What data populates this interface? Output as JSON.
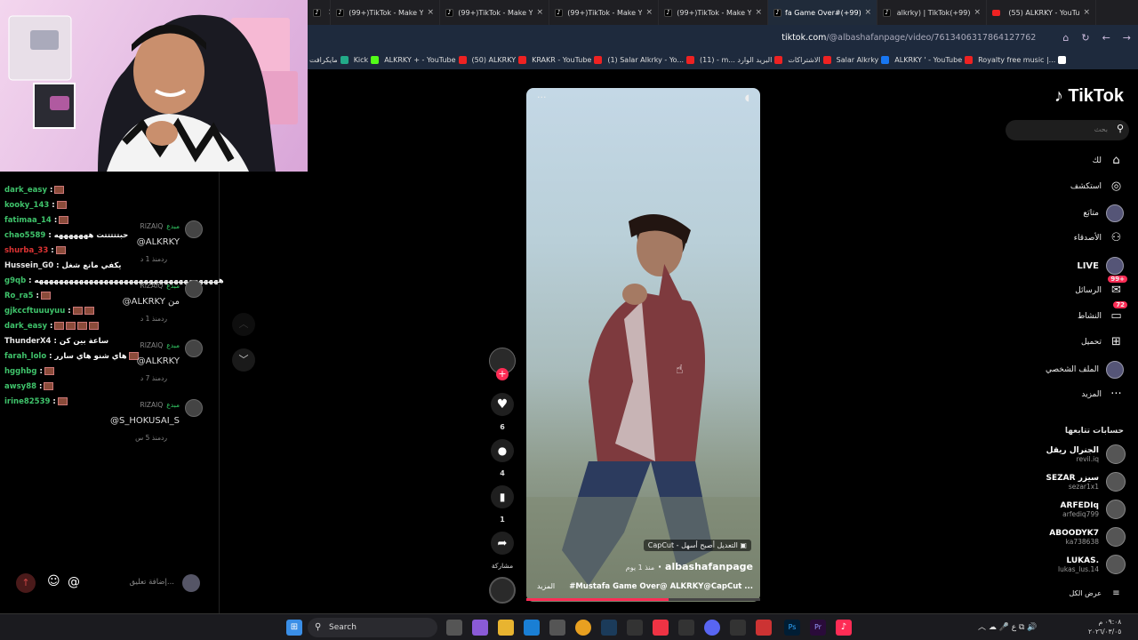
{
  "tabs": [
    {
      "label": "n",
      "icon": "tiktok-icon",
      "active": false
    },
    {
      "label": "(99+)TikTok - Make Y",
      "icon": "tiktok-icon",
      "active": false
    },
    {
      "label": "(99+)TikTok - Make Y",
      "icon": "tiktok-icon",
      "active": false
    },
    {
      "label": "(99+)TikTok - Make Y",
      "icon": "tiktok-icon",
      "active": false
    },
    {
      "label": "(99+)TikTok - Make Y",
      "icon": "tiktok-icon",
      "active": false
    },
    {
      "label": "fa Game Over#(+99)",
      "icon": "tiktok-icon",
      "active": true
    },
    {
      "label": "alkrky) | TikTok(+99)",
      "icon": "tiktok-icon",
      "active": false
    },
    {
      "label": "(55) ALKRKY - YouTu",
      "icon": "youtube-icon",
      "active": false
    }
  ],
  "address": {
    "domain": "tiktok.com",
    "path": "/@albashafanpage/video/7613406317864127762"
  },
  "bookmarks": [
    "مايكرافت",
    "Kick",
    "ALKRKY + - YouTube",
    "(50) ALKRKY",
    "KRAKR - YouTube",
    "(1) Salar Alkrky - Yo...",
    "(11) - m... البريد الوارد",
    "الاشتراكات",
    "Salar Alkrky",
    "ALKRKY ' - YouTube",
    "Royalty free music |..."
  ],
  "chat": {
    "lines": [
      {
        "user": "dark_easy",
        "color": "#3fc36b",
        "text": ":",
        "emotes": 1
      },
      {
        "user": "kooky_143",
        "color": "#3fc36b",
        "text": ":",
        "emotes": 1
      },
      {
        "user": "fatimaa_14",
        "color": "#3fc36b",
        "text": ":",
        "emotes": 1
      },
      {
        "user": "chao5589",
        "color": "#3fc36b",
        "text": ": حبتتتتتت هههههههه",
        "emotes": 0
      },
      {
        "user": "shurba_33",
        "color": "#d33",
        "text": ":",
        "emotes": 1
      },
      {
        "user": "Hussein_G0",
        "color": "#e8e8e8",
        "text": ": يكفي مانع شغل",
        "emotes": 0
      },
      {
        "user": "g9qb",
        "color": "#3fc36b",
        "text": ": هههههههههههههههههههههههههههههههههههههه",
        "emotes": 0
      },
      {
        "user": "Ro_ra5",
        "color": "#3fc36b",
        "text": ":",
        "emotes": 1
      },
      {
        "user": "gjkccftuuuyuu",
        "color": "#3fc36b",
        "text": ":",
        "emotes": 2
      },
      {
        "user": "dark_easy",
        "color": "#3fc36b",
        "text": ":",
        "emotes": 4
      },
      {
        "user": "ThunderX4",
        "color": "#e8e8e8",
        "text": ": ساعة بين كن",
        "emotes": 0
      },
      {
        "user": "farah_lolo",
        "color": "#3fc36b",
        "text": ": هاي شنو هاي سارر",
        "emotes": 1
      },
      {
        "user": "hgghbg",
        "color": "#3fc36b",
        "text": ":",
        "emotes": 1
      },
      {
        "user": "awsy88",
        "color": "#3fc36b",
        "text": ":",
        "emotes": 1
      },
      {
        "user": "irine82539",
        "color": "#3fc36b",
        "text": ":",
        "emotes": 1
      }
    ],
    "comments": [
      {
        "author": "RIZAIQ",
        "tag": "مبدع",
        "text": "@ALKRKY",
        "time": "منذ 1 د",
        "reply": "رد"
      },
      {
        "author": "RIZAIQ",
        "tag": "مبدع",
        "text": "@ALKRKY من",
        "time": "منذ 1 د",
        "reply": "رد"
      },
      {
        "author": "RIZAIQ",
        "tag": "مبدع",
        "text": "@ALKRKY",
        "time": "منذ 7 د",
        "reply": "رد"
      },
      {
        "author": "RIZAIQ",
        "tag": "مبدع",
        "text": "@S_HOKUSAI_S",
        "time": "منذ 5 س",
        "reply": "رد"
      }
    ],
    "input_placeholder": "إضافة تعليق..."
  },
  "video": {
    "capcut_badge": "CapCut - التعديل أصبح أسهل",
    "author": "albashafanpage",
    "time": "منذ 1 يوم",
    "caption": "#Mustafa Game Over@ ALKRKY@CapCut ...",
    "more": "المزيد",
    "progress": 0.61
  },
  "actions": {
    "likes": "6",
    "comments": "4",
    "saves": "1",
    "share": "مشاركة"
  },
  "sidebar": {
    "logo": "TikTok",
    "search_placeholder": "بحث",
    "items": [
      {
        "label": "لك",
        "icon": "home-icon"
      },
      {
        "label": "استكشف",
        "icon": "compass-icon"
      },
      {
        "label": "متابَع",
        "icon": "avatar-icon"
      },
      {
        "label": "الأصدقاء",
        "icon": "friends-icon"
      },
      {
        "label": "LIVE",
        "icon": "live-icon"
      },
      {
        "label": "الرسائل",
        "icon": "messages-icon",
        "badge": "99+"
      },
      {
        "label": "النشاط",
        "icon": "activity-icon",
        "badge": "72"
      },
      {
        "label": "تحميل",
        "icon": "upload-icon"
      },
      {
        "label": "الملف الشخصي",
        "icon": "profile-icon"
      },
      {
        "label": "المزيد",
        "icon": "more-icon"
      }
    ],
    "following_title": "حسابات تتابعها",
    "following": [
      {
        "name": "الجنرال ريقل",
        "handle": "revil.iq"
      },
      {
        "name": "SEZAR سيزر",
        "handle": "sezar1x1"
      },
      {
        "name": "ARFEDIq",
        "handle": "arfediq799"
      },
      {
        "name": "ABOODYK7",
        "handle": "ka738638"
      },
      {
        "name": "LUKAS.",
        "handle": "lukas_lus.14"
      }
    ],
    "see_all": "عرض الكل"
  },
  "taskbar": {
    "search_label": "Search",
    "time": "٠٩:٠٨ م",
    "date": "٢٠٢٦/٠٣/٠٥",
    "lang": "ع"
  }
}
